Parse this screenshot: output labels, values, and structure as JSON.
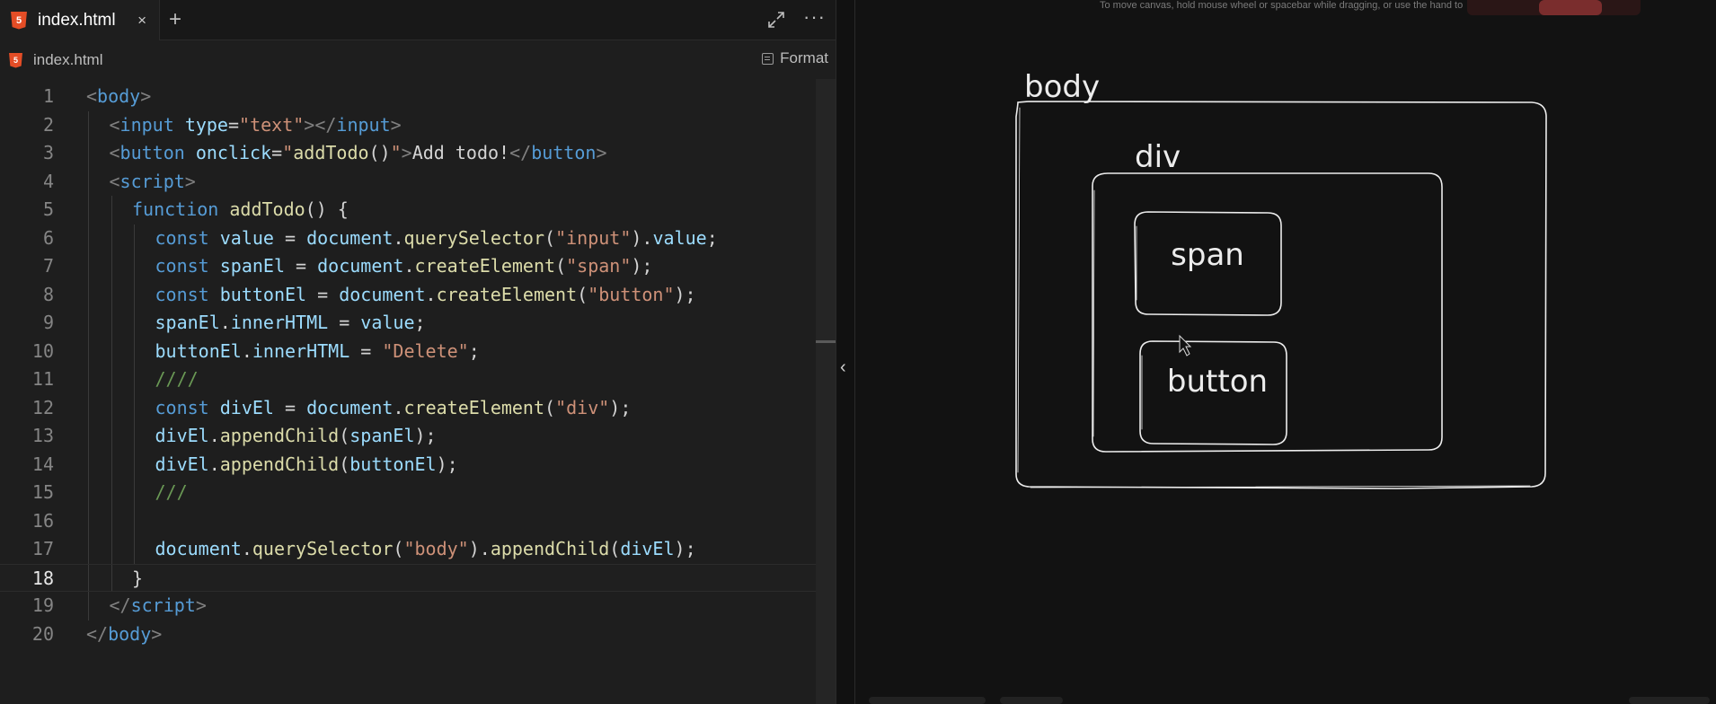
{
  "editor": {
    "tab_label": "index.html",
    "tab_close": "×",
    "new_tab": "+",
    "more": "···",
    "file_icon": "html5-icon",
    "breadcrumb": "index.html",
    "format_label": "Format"
  },
  "code": {
    "current_line": 18,
    "lines": [
      {
        "n": "1",
        "indent": 0,
        "tokens": [
          [
            "t-tag",
            "<"
          ],
          [
            "t-name",
            "body"
          ],
          [
            "t-tag",
            ">"
          ]
        ]
      },
      {
        "n": "2",
        "indent": 1,
        "tokens": [
          [
            "t-tag",
            "<"
          ],
          [
            "t-name",
            "input"
          ],
          [
            "t-punc",
            " "
          ],
          [
            "t-attr",
            "type"
          ],
          [
            "t-punc",
            "="
          ],
          [
            "t-str",
            "\"text\""
          ],
          [
            "t-tag",
            "></"
          ],
          [
            "t-name",
            "input"
          ],
          [
            "t-tag",
            ">"
          ]
        ]
      },
      {
        "n": "3",
        "indent": 1,
        "tokens": [
          [
            "t-tag",
            "<"
          ],
          [
            "t-name",
            "button"
          ],
          [
            "t-punc",
            " "
          ],
          [
            "t-attr",
            "onclick"
          ],
          [
            "t-punc",
            "="
          ],
          [
            "t-str",
            "\""
          ],
          [
            "t-fn",
            "addTodo"
          ],
          [
            "t-punc",
            "()"
          ],
          [
            "t-str",
            "\""
          ],
          [
            "t-tag",
            ">"
          ],
          [
            "t-punc",
            "Add todo!"
          ],
          [
            "t-tag",
            "</"
          ],
          [
            "t-name",
            "button"
          ],
          [
            "t-tag",
            ">"
          ]
        ]
      },
      {
        "n": "4",
        "indent": 1,
        "tokens": [
          [
            "t-tag",
            "<"
          ],
          [
            "t-name",
            "script"
          ],
          [
            "t-tag",
            ">"
          ]
        ]
      },
      {
        "n": "5",
        "indent": 2,
        "tokens": [
          [
            "t-kw",
            "function"
          ],
          [
            "t-punc",
            " "
          ],
          [
            "t-fn",
            "addTodo"
          ],
          [
            "t-punc",
            "() {"
          ]
        ]
      },
      {
        "n": "6",
        "indent": 3,
        "tokens": [
          [
            "t-kw",
            "const"
          ],
          [
            "t-punc",
            " "
          ],
          [
            "t-var",
            "value"
          ],
          [
            "t-punc",
            " = "
          ],
          [
            "t-var",
            "document"
          ],
          [
            "t-punc",
            "."
          ],
          [
            "t-fn",
            "querySelector"
          ],
          [
            "t-punc",
            "("
          ],
          [
            "t-str",
            "\"input\""
          ],
          [
            "t-punc",
            ")."
          ],
          [
            "t-var",
            "value"
          ],
          [
            "t-punc",
            ";"
          ]
        ]
      },
      {
        "n": "7",
        "indent": 3,
        "tokens": [
          [
            "t-kw",
            "const"
          ],
          [
            "t-punc",
            " "
          ],
          [
            "t-var",
            "spanEl"
          ],
          [
            "t-punc",
            " = "
          ],
          [
            "t-var",
            "document"
          ],
          [
            "t-punc",
            "."
          ],
          [
            "t-fn",
            "createElement"
          ],
          [
            "t-punc",
            "("
          ],
          [
            "t-str",
            "\"span\""
          ],
          [
            "t-punc",
            ");"
          ]
        ]
      },
      {
        "n": "8",
        "indent": 3,
        "tokens": [
          [
            "t-kw",
            "const"
          ],
          [
            "t-punc",
            " "
          ],
          [
            "t-var",
            "buttonEl"
          ],
          [
            "t-punc",
            " = "
          ],
          [
            "t-var",
            "document"
          ],
          [
            "t-punc",
            "."
          ],
          [
            "t-fn",
            "createElement"
          ],
          [
            "t-punc",
            "("
          ],
          [
            "t-str",
            "\"button\""
          ],
          [
            "t-punc",
            ");"
          ]
        ]
      },
      {
        "n": "9",
        "indent": 3,
        "tokens": [
          [
            "t-var",
            "spanEl"
          ],
          [
            "t-punc",
            "."
          ],
          [
            "t-var",
            "innerHTML"
          ],
          [
            "t-punc",
            " = "
          ],
          [
            "t-var",
            "value"
          ],
          [
            "t-punc",
            ";"
          ]
        ]
      },
      {
        "n": "10",
        "indent": 3,
        "tokens": [
          [
            "t-var",
            "buttonEl"
          ],
          [
            "t-punc",
            "."
          ],
          [
            "t-var",
            "innerHTML"
          ],
          [
            "t-punc",
            " = "
          ],
          [
            "t-str",
            "\"Delete\""
          ],
          [
            "t-punc",
            ";"
          ]
        ]
      },
      {
        "n": "11",
        "indent": 3,
        "tokens": [
          [
            "t-cmt",
            "////"
          ]
        ]
      },
      {
        "n": "12",
        "indent": 3,
        "tokens": [
          [
            "t-kw",
            "const"
          ],
          [
            "t-punc",
            " "
          ],
          [
            "t-var",
            "divEl"
          ],
          [
            "t-punc",
            " = "
          ],
          [
            "t-var",
            "document"
          ],
          [
            "t-punc",
            "."
          ],
          [
            "t-fn",
            "createElement"
          ],
          [
            "t-punc",
            "("
          ],
          [
            "t-str",
            "\"div\""
          ],
          [
            "t-punc",
            ");"
          ]
        ]
      },
      {
        "n": "13",
        "indent": 3,
        "tokens": [
          [
            "t-var",
            "divEl"
          ],
          [
            "t-punc",
            "."
          ],
          [
            "t-fn",
            "appendChild"
          ],
          [
            "t-punc",
            "("
          ],
          [
            "t-var",
            "spanEl"
          ],
          [
            "t-punc",
            ");"
          ]
        ]
      },
      {
        "n": "14",
        "indent": 3,
        "tokens": [
          [
            "t-var",
            "divEl"
          ],
          [
            "t-punc",
            "."
          ],
          [
            "t-fn",
            "appendChild"
          ],
          [
            "t-punc",
            "("
          ],
          [
            "t-var",
            "buttonEl"
          ],
          [
            "t-punc",
            ");"
          ]
        ]
      },
      {
        "n": "15",
        "indent": 3,
        "tokens": [
          [
            "t-cmt",
            "///"
          ]
        ]
      },
      {
        "n": "16",
        "indent": 3,
        "tokens": []
      },
      {
        "n": "17",
        "indent": 3,
        "tokens": [
          [
            "t-var",
            "document"
          ],
          [
            "t-punc",
            "."
          ],
          [
            "t-fn",
            "querySelector"
          ],
          [
            "t-punc",
            "("
          ],
          [
            "t-str",
            "\"body\""
          ],
          [
            "t-punc",
            ")."
          ],
          [
            "t-fn",
            "appendChild"
          ],
          [
            "t-punc",
            "("
          ],
          [
            "t-var",
            "divEl"
          ],
          [
            "t-punc",
            ");"
          ]
        ]
      },
      {
        "n": "18",
        "indent": 2,
        "tokens": [
          [
            "t-punc",
            "}"
          ]
        ]
      },
      {
        "n": "19",
        "indent": 1,
        "tokens": [
          [
            "t-tag",
            "</"
          ],
          [
            "t-name",
            "script"
          ],
          [
            "t-tag",
            ">"
          ]
        ]
      },
      {
        "n": "20",
        "indent": 0,
        "tokens": [
          [
            "t-tag",
            "</"
          ],
          [
            "t-name",
            "body"
          ],
          [
            "t-tag",
            ">"
          ]
        ]
      }
    ]
  },
  "canvas": {
    "hint": "To move canvas, hold mouse wheel or spacebar while dragging, or use the hand to",
    "labels": {
      "body": "body",
      "div": "div",
      "span": "span",
      "button": "button"
    }
  },
  "colors": {
    "editor_bg": "#1e1e1e",
    "canvas_bg": "#121212",
    "sketch_stroke": "#ececec",
    "html5_orange": "#e44d26"
  }
}
